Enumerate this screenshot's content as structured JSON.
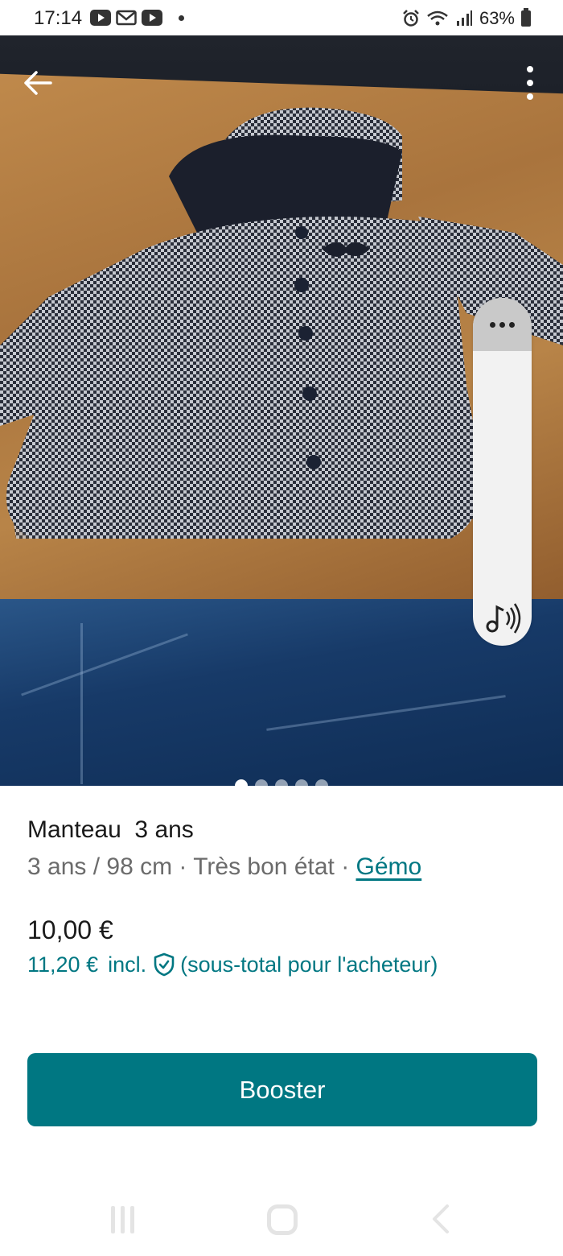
{
  "status_bar": {
    "time": "17:14",
    "battery": "63%"
  },
  "listing": {
    "title": "Manteau  3 ans",
    "size_condition": "3 ans / 98 cm · Très bon état · ",
    "brand": "Gémo",
    "price": "10,00 €",
    "buyer_price": "11,20 €",
    "buyer_incl": "incl.",
    "buyer_note": "(sous-total pour l'acheteur)",
    "photo_count": 5,
    "active_photo": 1
  },
  "actions": {
    "booster_label": "Booster"
  },
  "colors": {
    "accent": "#007782",
    "text": "#1a1a1a",
    "muted": "#6b6b6b"
  },
  "icons": [
    "back-arrow-icon",
    "more-vertical-icon",
    "more-horizontal-icon",
    "audio-icon",
    "shield-check-icon"
  ]
}
